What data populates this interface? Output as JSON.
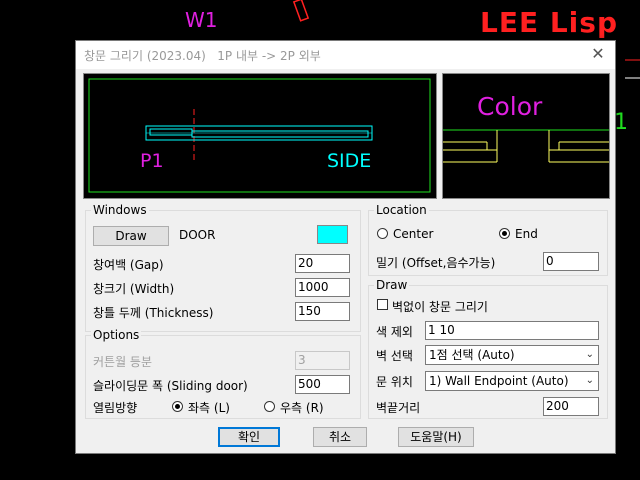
{
  "background": {
    "labels": {
      "w1": "W1",
      "lee_lisp": "LEE Lisp",
      "side_one": "1"
    },
    "colors": {
      "cad_bg": "#000000",
      "magenta": "#e020e0",
      "red": "#ff2020",
      "green": "#20e020"
    }
  },
  "dialog": {
    "title": "창문 그리기 (2023.04)   1P 내부 -> 2P 외부",
    "close_icon": "close-icon",
    "preview": {
      "p1": "P1",
      "side": "SIDE"
    },
    "color_preview": {
      "label": "Color"
    },
    "windows": {
      "label": "Windows",
      "draw_button": "Draw",
      "door_label": "DOOR",
      "swatch_color": "#00ffff",
      "gap_label": "창여백 (Gap)",
      "gap_value": "20",
      "width_label": "창크기 (Width)",
      "width_value": "1000",
      "thickness_label": "창틀 두께 (Thickness)",
      "thickness_value": "150"
    },
    "options": {
      "label": "Options",
      "curtain_label": "커튼월 등분",
      "curtain_value": "3",
      "sliding_label": "슬라이딩문 폭 (Sliding door)",
      "sliding_value": "500",
      "direction_label": "열림방향",
      "left_label": "좌측 (L)",
      "right_label": "우측 (R)",
      "selected": "left"
    },
    "location": {
      "label": "Location",
      "center_label": "Center",
      "end_label": "End",
      "selected": "end",
      "offset_label": "밀기 (Offset,음수가능)",
      "offset_value": "0"
    },
    "draw": {
      "label": "Draw",
      "no_wall_label": "벽없이 창문 그리기",
      "no_wall_checked": false,
      "exclude_color_label": "색 제외",
      "exclude_color_value": "1 10",
      "wall_select_label": "벽 선택",
      "wall_select_value": "1점 선택 (Auto)",
      "door_pos_label": "문 위치",
      "door_pos_value": "1) Wall Endpoint (Auto)",
      "wall_end_label": "벽끝거리",
      "wall_end_value": "200"
    },
    "buttons": {
      "ok": "확인",
      "cancel": "취소",
      "help": "도움말(H)"
    }
  }
}
